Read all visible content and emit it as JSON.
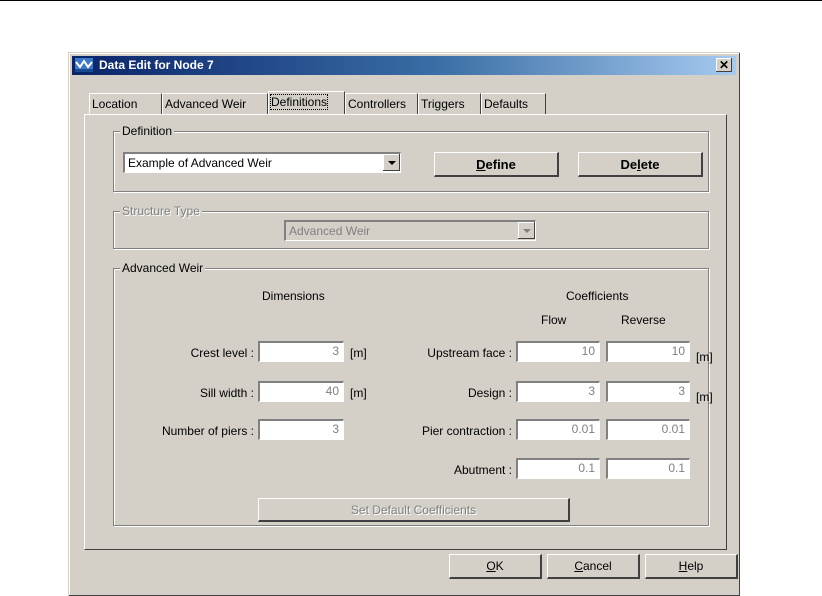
{
  "window": {
    "title": "Data Edit for Node 7"
  },
  "tabs": [
    "Location",
    "Advanced Weir",
    "Definitions",
    "Controllers",
    "Triggers",
    "Defaults"
  ],
  "active_tab": "Definitions",
  "definition": {
    "group_label": "Definition",
    "selected": "Example of Advanced Weir",
    "define_pre": "",
    "define_key": "D",
    "define_post": "efine",
    "delete_pre": "De",
    "delete_key": "l",
    "delete_post": "ete"
  },
  "structure_type": {
    "group_label": "Structure Type",
    "selected": "Advanced Weir"
  },
  "advanced_weir": {
    "group_label": "Advanced Weir",
    "dimensions_header": "Dimensions",
    "coefficients_header": "Coefficients",
    "flow_header": "Flow",
    "reverse_header": "Reverse",
    "crest_level": {
      "label": "Crest level :",
      "value": "3",
      "unit": "[m]"
    },
    "sill_width": {
      "label": "Sill width :",
      "value": "40",
      "unit": "[m]"
    },
    "number_of_piers": {
      "label": "Number of piers :",
      "value": "3"
    },
    "upstream_face": {
      "label": "Upstream face :",
      "flow": "10",
      "reverse": "10",
      "unit": "[m]"
    },
    "design": {
      "label": "Design :",
      "flow": "3",
      "reverse": "3",
      "unit": "[m]"
    },
    "pier_contraction": {
      "label": "Pier contraction :",
      "flow": "0.01",
      "reverse": "0.01"
    },
    "abutment": {
      "label": "Abutment :",
      "flow": "0.1",
      "reverse": "0.1"
    },
    "set_default_label": "Set Default Coefficients"
  },
  "footer": {
    "ok_key": "O",
    "ok_post": "K",
    "cancel_key": "C",
    "cancel_post": "ancel",
    "help_key": "H",
    "help_post": "elp"
  }
}
